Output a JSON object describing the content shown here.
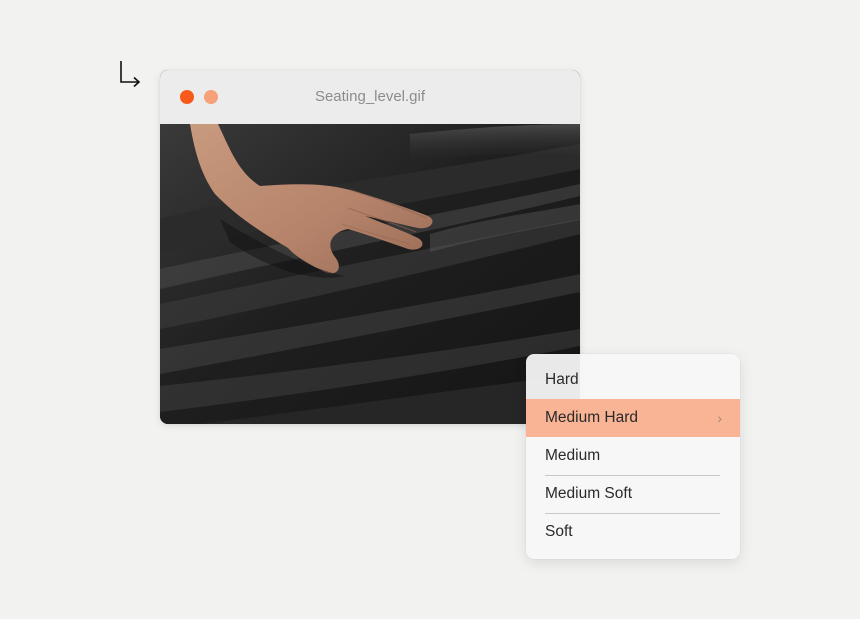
{
  "window": {
    "title": "Seating_level.gif",
    "controls": {
      "close_color": "#f75a1a",
      "minimize_color": "#f7a079"
    }
  },
  "image": {
    "description_icon": "hand-on-leather-seat-image"
  },
  "menu": {
    "accent": "#f8b494",
    "items": [
      {
        "label": "Hard",
        "selected": false,
        "has_submenu": false
      },
      {
        "label": "Medium Hard",
        "selected": true,
        "has_submenu": true
      },
      {
        "label": "Medium",
        "selected": false,
        "has_submenu": false
      },
      {
        "label": "Medium Soft",
        "selected": false,
        "has_submenu": false
      },
      {
        "label": "Soft",
        "selected": false,
        "has_submenu": false
      }
    ],
    "submenu_glyph": "›"
  }
}
